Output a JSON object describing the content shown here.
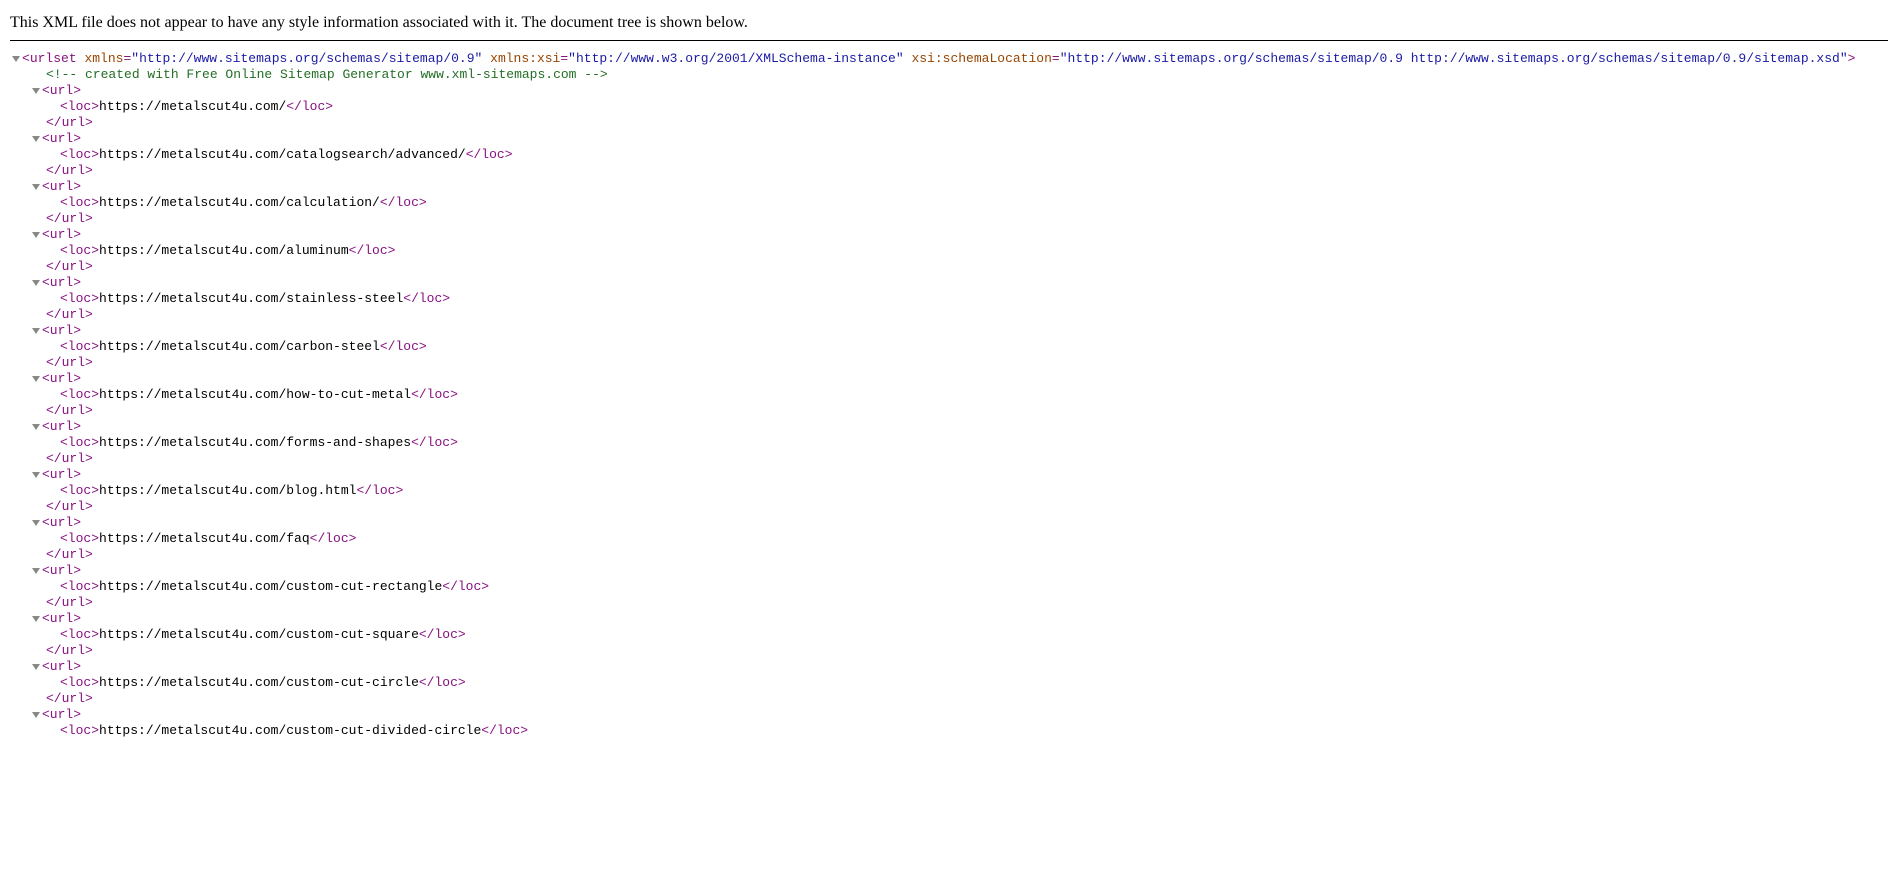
{
  "header_message": "This XML file does not appear to have any style information associated with it. The document tree is shown below.",
  "root_tag": "urlset",
  "root_attrs": [
    {
      "name": "xmlns",
      "value": "\"http://www.sitemaps.org/schemas/sitemap/0.9\""
    },
    {
      "name": "xmlns:xsi",
      "value": "\"http://www.w3.org/2001/XMLSchema-instance\""
    },
    {
      "name": "xsi:schemaLocation",
      "value": "\"http://www.sitemaps.org/schemas/sitemap/0.9 http://www.sitemaps.org/schemas/sitemap/0.9/sitemap.xsd\""
    }
  ],
  "root_close": ">",
  "comment_text": "<!--  created with Free Online Sitemap Generator www.xml-sitemaps.com  -->",
  "url_open": "<url>",
  "url_close": "</url>",
  "loc_open": "<loc>",
  "loc_close": "</loc>",
  "urls": [
    {
      "loc": "https://metalscut4u.com/"
    },
    {
      "loc": "https://metalscut4u.com/catalogsearch/advanced/"
    },
    {
      "loc": "https://metalscut4u.com/calculation/"
    },
    {
      "loc": "https://metalscut4u.com/aluminum"
    },
    {
      "loc": "https://metalscut4u.com/stainless-steel"
    },
    {
      "loc": "https://metalscut4u.com/carbon-steel"
    },
    {
      "loc": "https://metalscut4u.com/how-to-cut-metal"
    },
    {
      "loc": "https://metalscut4u.com/forms-and-shapes"
    },
    {
      "loc": "https://metalscut4u.com/blog.html"
    },
    {
      "loc": "https://metalscut4u.com/faq"
    },
    {
      "loc": "https://metalscut4u.com/custom-cut-rectangle"
    },
    {
      "loc": "https://metalscut4u.com/custom-cut-square"
    },
    {
      "loc": "https://metalscut4u.com/custom-cut-circle"
    },
    {
      "loc": "https://metalscut4u.com/custom-cut-divided-circle"
    }
  ],
  "root_open_prefix": "<",
  "space": " "
}
